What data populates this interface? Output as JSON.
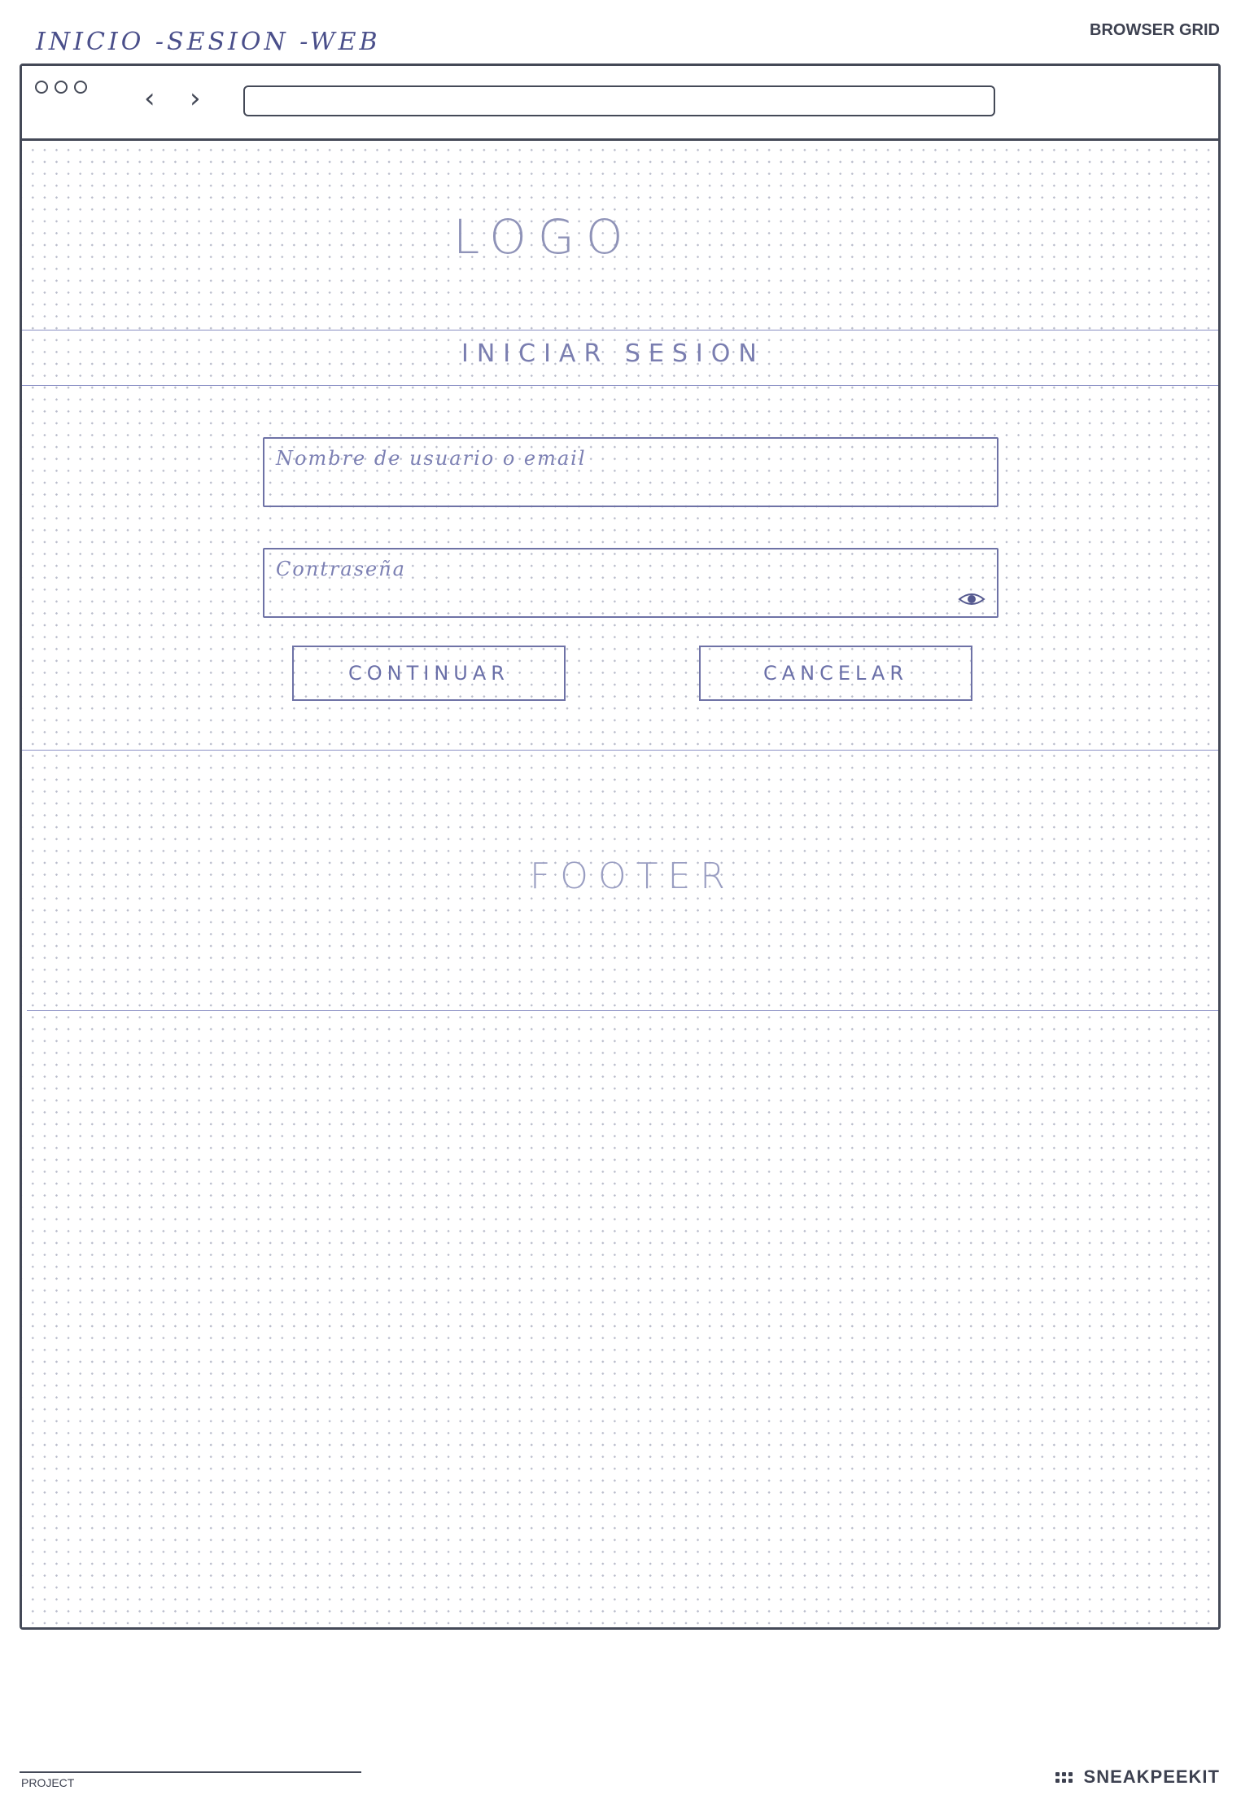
{
  "sheet": {
    "title": "INICIO -SESION -WEB",
    "type_label": "BROWSER GRID",
    "project_label": "PROJECT",
    "brand": "SNEAKPEEKIT"
  },
  "browser": {
    "window_controls": [
      "close-dot",
      "minimize-dot",
      "maximize-dot"
    ],
    "back_icon": "‹",
    "forward_icon": "›",
    "url": ""
  },
  "page": {
    "logo_text": "LOGO",
    "heading": "INICIAR SESION",
    "username_placeholder": "Nombre de usuario o email",
    "password_placeholder": "Contraseña",
    "password_toggle_icon": "eye-icon",
    "continue_label": "CONTINUAR",
    "cancel_label": "CANCELAR",
    "footer_text": "FOOTER"
  },
  "colors": {
    "frame": "#444957",
    "sketch_ink": "#6a6fa8",
    "grid_dot": "#b9bccb"
  }
}
